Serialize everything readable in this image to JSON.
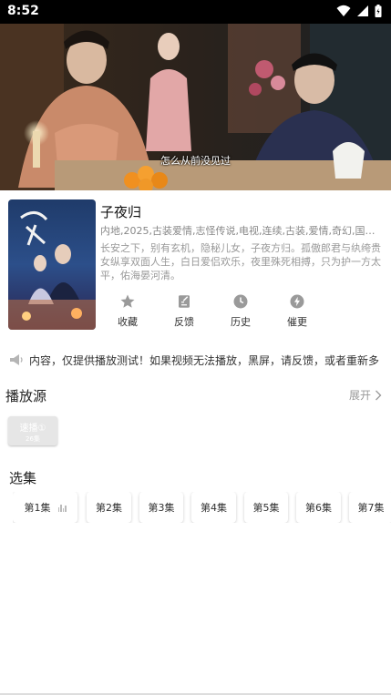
{
  "status_bar": {
    "time": "8:52"
  },
  "video": {
    "subtitle": "怎么从前没见过"
  },
  "show": {
    "title": "子夜归",
    "tags": "内地,2025,古装爱情,志怪传说,电视,连续,古装,爱情,奇幻,国产,...",
    "description": "长安之下，别有玄机，隐秘儿女，子夜方归。孤傲郎君与纨绔贵女纵享双面人生，白日爱侣欢乐，夜里殊死相搏，只为护一方太平，佑海晏河清。"
  },
  "actions": [
    {
      "label": "收藏",
      "icon": "star-icon"
    },
    {
      "label": "反馈",
      "icon": "feedback-icon"
    },
    {
      "label": "历史",
      "icon": "clock-icon"
    },
    {
      "label": "催更",
      "icon": "lightning-icon"
    }
  ],
  "notice": {
    "text": "内容，仅提供播放测试！如果视频无法播放，黑屏，请反馈，或者重新多"
  },
  "sources": {
    "title": "播放源",
    "expand_label": "展开",
    "items": [
      {
        "name": "速播①",
        "count": "26集"
      }
    ]
  },
  "episodes": {
    "title": "选集",
    "items": [
      "第1集",
      "第2集",
      "第3集",
      "第4集",
      "第5集",
      "第6集",
      "第7集"
    ]
  },
  "colors": {
    "accent": "#e6e6e6",
    "icon_gray": "#9a9a9a"
  }
}
